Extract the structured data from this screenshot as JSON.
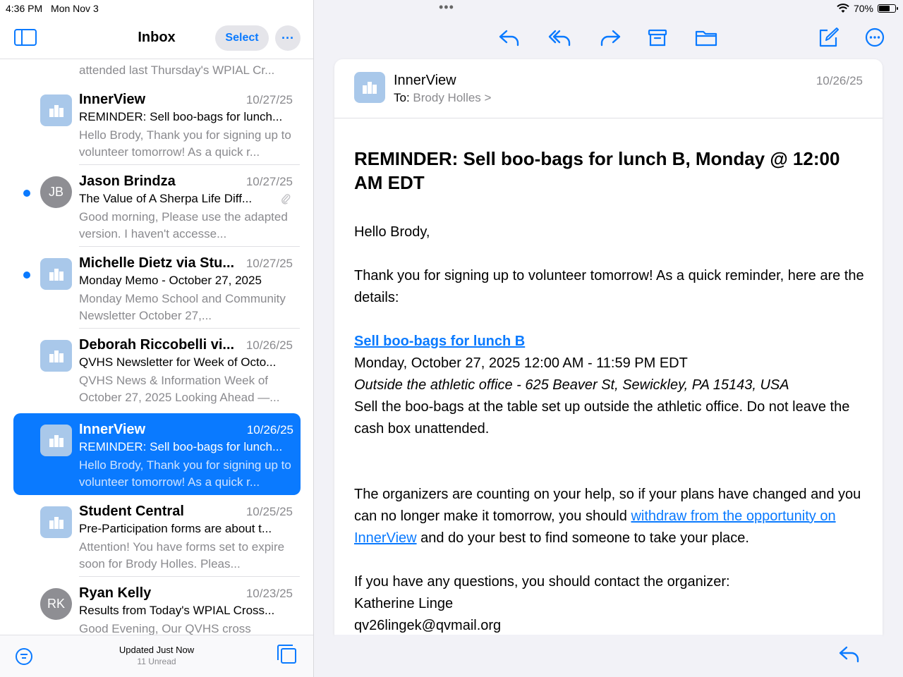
{
  "status": {
    "time": "4:36 PM",
    "date": "Mon Nov 3",
    "battery": "70%",
    "battery_level": 0.7,
    "dots": "•••"
  },
  "sidebar": {
    "title": "Inbox",
    "select_label": "Select",
    "more_label": "···",
    "partial_preview": "attended last Thursday's WPIAL Cr...",
    "footer_updated": "Updated Just Now",
    "footer_unread": "11 Unread"
  },
  "mails": [
    {
      "sender": "InnerView",
      "date": "10/27/25",
      "subject": "REMINDER: Sell boo-bags for lunch...",
      "preview": "Hello Brody, Thank you for signing up to volunteer tomorrow! As a quick r...",
      "initials": "",
      "unread": false,
      "attachment": false
    },
    {
      "sender": "Jason Brindza",
      "date": "10/27/25",
      "subject": "The Value of A Sherpa Life Diff...",
      "preview": "Good morning, Please use the adapted version. I haven't accesse...",
      "initials": "JB",
      "unread": true,
      "attachment": true
    },
    {
      "sender": "Michelle Dietz via Stu...",
      "date": "10/27/25",
      "subject": "Monday Memo - October 27, 2025",
      "preview": "Monday Memo School and Community Newsletter October 27,...",
      "initials": "",
      "unread": true,
      "attachment": false
    },
    {
      "sender": "Deborah Riccobelli vi...",
      "date": "10/26/25",
      "subject": "QVHS Newsletter for Week of Octo...",
      "preview": "QVHS News & Information Week of October 27, 2025 Looking Ahead —...",
      "initials": "",
      "unread": false,
      "attachment": false
    },
    {
      "sender": "InnerView",
      "date": "10/26/25",
      "subject": "REMINDER: Sell boo-bags for lunch...",
      "preview": "Hello Brody, Thank you for signing up to volunteer tomorrow! As a quick r...",
      "initials": "",
      "unread": false,
      "attachment": false,
      "selected": true
    },
    {
      "sender": "Student Central",
      "date": "10/25/25",
      "subject": "Pre-Participation forms are about t...",
      "preview": "Attention! You have forms set to expire soon for Brody Holles. Pleas...",
      "initials": "",
      "unread": false,
      "attachment": false
    },
    {
      "sender": "Ryan Kelly",
      "date": "10/23/25",
      "subject": "Results from Today's WPIAL Cross...",
      "preview": "Good Evening, Our QVHS cross country team...",
      "initials": "RK",
      "unread": false,
      "attachment": false
    }
  ],
  "message": {
    "from": "InnerView",
    "to_label": "To:",
    "to_name": "Brody Holles",
    "to_chevron": ">",
    "date": "10/26/25",
    "subject": "REMINDER: Sell boo-bags for lunch B,  Monday @ 12:00 AM EDT",
    "greeting": "Hello Brody,",
    "intro": "Thank you for signing up to volunteer tomorrow! As a quick reminder, here are the details:",
    "event_link": "Sell boo-bags for lunch B",
    "event_time": "Monday, October 27, 2025 12:00 AM - 11:59 PM EDT",
    "event_location": "Outside the athletic office - 625 Beaver St, Sewickley, PA 15143, USA",
    "event_desc": "Sell the boo-bags at the table set up outside the athletic office. Do not leave the cash box unattended.",
    "para_before_link": "The organizers are counting on your help, so if your plans have changed and you can no longer make it tomorrow, you should ",
    "withdraw_link": "withdraw from the opportunity on InnerView",
    "para_after_link": " and do your best to find someone to take your place.",
    "contact_intro": "If you have any questions, you should contact the organizer:",
    "contact_name": "Katherine Linge",
    "contact_email": "qv26lingek@qvmail.org"
  },
  "icons": {
    "reply": "reply-icon",
    "reply_all": "reply-all-icon",
    "forward": "forward-icon",
    "archive": "archive-icon",
    "folder": "folder-icon",
    "compose": "compose-icon",
    "more": "more-icon"
  },
  "colors": {
    "accent": "#0a7aff",
    "avatar_bg": "#a9c8ea",
    "gray_text": "#8a8a8e"
  }
}
